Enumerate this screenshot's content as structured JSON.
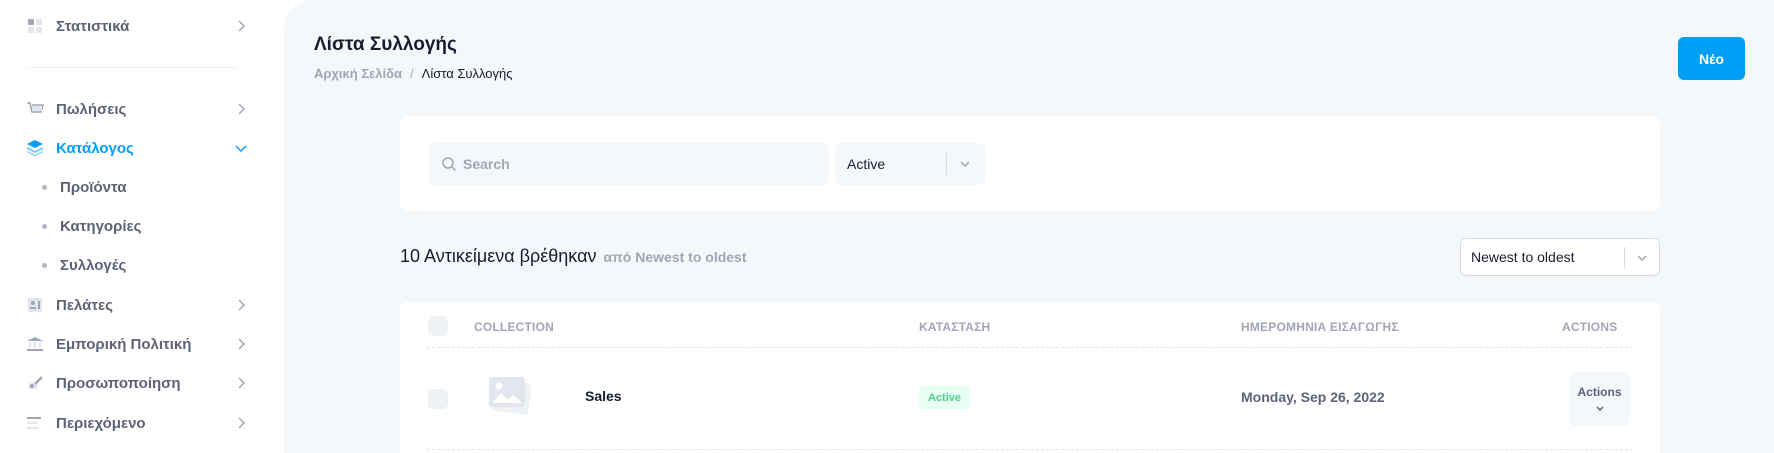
{
  "sidebar": {
    "items": [
      {
        "label": "Στατιστικά",
        "icon": "dashboard-icon"
      },
      {
        "label": "Πωλήσεις",
        "icon": "cart-icon"
      },
      {
        "label": "Κατάλογος",
        "icon": "layers-icon"
      },
      {
        "label": "Πελάτες",
        "icon": "contacts-icon"
      },
      {
        "label": "Εμπορική Πολιτική",
        "icon": "bank-icon"
      },
      {
        "label": "Προσωποποίηση",
        "icon": "brush-icon"
      },
      {
        "label": "Περιεχόμενο",
        "icon": "text-align-icon"
      }
    ],
    "catalog_sub": [
      "Προϊόντα",
      "Κατηγορίες",
      "Συλλογές"
    ]
  },
  "header": {
    "title": "Λίστα Συλλογής",
    "breadcrumb": {
      "home": "Αρχική Σελίδα",
      "separator": "/",
      "current": "Λίστα Συλλογής"
    },
    "new_button": "Νέο"
  },
  "filters": {
    "search_placeholder": "Search",
    "status_value": "Active"
  },
  "results": {
    "count_text": "10 Αντικείμενα βρέθηκαν",
    "sort_note": "από Newest to oldest",
    "sort_value": "Newest to oldest"
  },
  "table": {
    "headers": {
      "collection": "Collection",
      "status": "Κατασταση",
      "date": "Ημερομηνια εισαγωγης",
      "actions": "Actions"
    },
    "rows": [
      {
        "name": "Sales",
        "status": "Active",
        "date": "Monday, Sep 26, 2022",
        "actions": "Actions"
      }
    ]
  },
  "colors": {
    "accent": "#009ef7",
    "success_text": "#50cd89",
    "success_bg": "#e8fff3",
    "muted": "#a1a5b7"
  }
}
